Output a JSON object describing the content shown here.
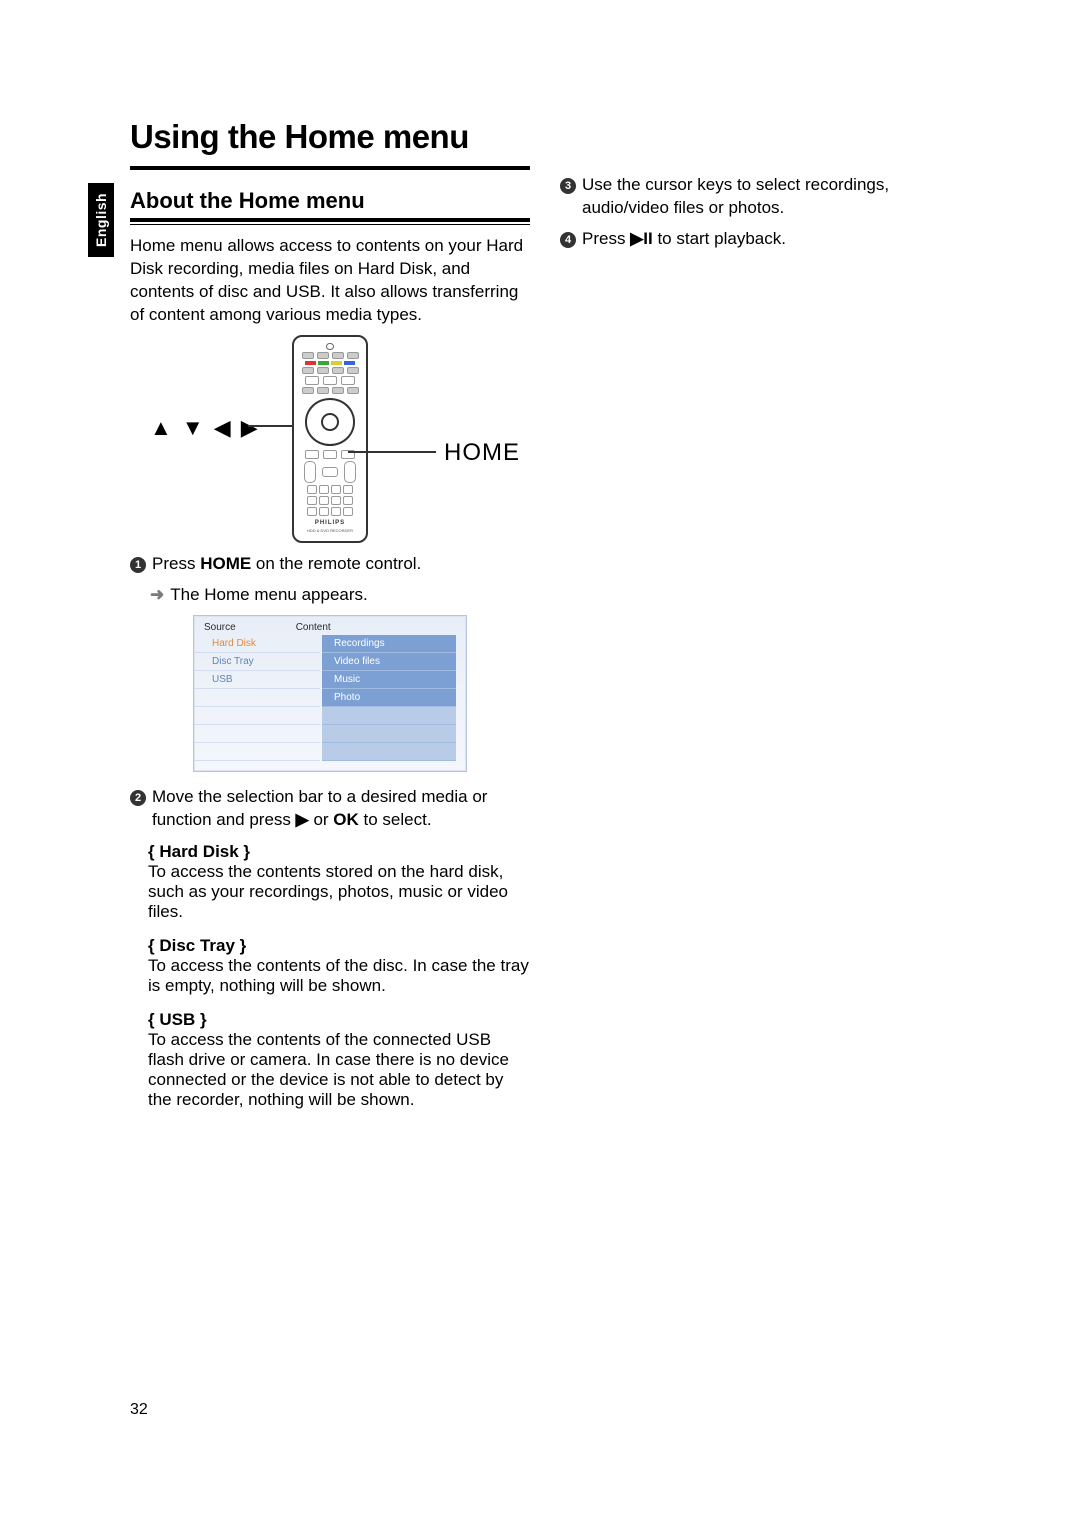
{
  "page_number": "32",
  "language_tab": "English",
  "title": "Using the Home menu",
  "sub_heading": "About the Home menu",
  "intro": "Home menu allows access to contents on your Hard Disk recording, media files on Hard Disk, and contents of disc and USB. It also allows transferring of content among various media types.",
  "remote": {
    "cursor_label": "▲ ▼ ◀ ▶",
    "home_label": "HOME"
  },
  "step1": {
    "text_a": "Press ",
    "key": "HOME",
    "text_b": " on the remote control.",
    "result": "The Home menu appears."
  },
  "menu": {
    "source_header": "Source",
    "content_header": "Content",
    "sources": [
      "Hard Disk",
      "Disc Tray",
      "USB"
    ],
    "contents": [
      "Recordings",
      "Video files",
      "Music",
      "Photo"
    ]
  },
  "step2": {
    "text_a": "Move the selection bar to a desired media or function and press ",
    "key1": "▶",
    "text_b": " or ",
    "key2": "OK",
    "text_c": " to select."
  },
  "options": {
    "hard_disk": {
      "label": "{ Hard Disk }",
      "desc": "To access the contents stored on the hard disk, such as your recordings, photos, music or video files."
    },
    "disc_tray": {
      "label": "{ Disc Tray }",
      "desc": "To access the contents of the disc. In case the tray is empty, nothing will be shown."
    },
    "usb": {
      "label": "{ USB }",
      "desc": "To access the contents of the connected USB flash drive or camera.  In case there is no device connected or the device is not able to detect by the recorder, nothing will be shown."
    }
  },
  "step3": "Use the cursor keys to select recordings, audio/video files or photos.",
  "step4": {
    "text_a": "Press ",
    "key": "▶II",
    "text_b": " to start playback."
  }
}
